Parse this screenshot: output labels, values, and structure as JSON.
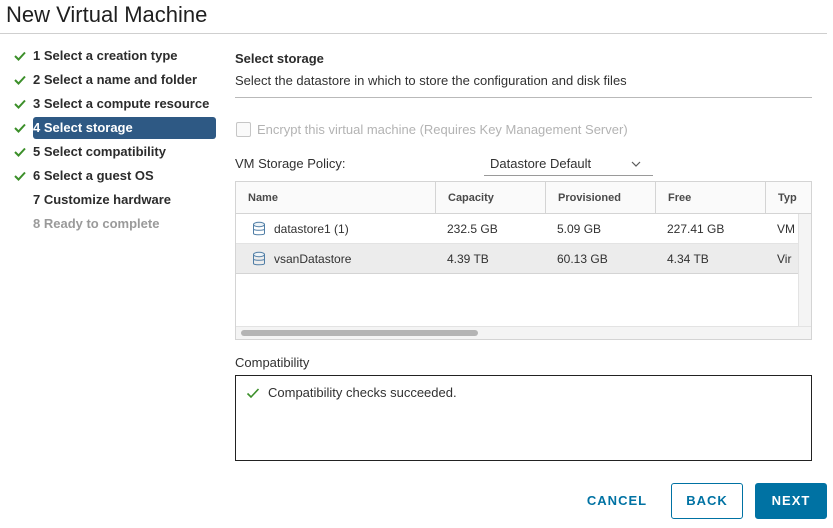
{
  "window": {
    "title": "New Virtual Machine"
  },
  "steps": [
    {
      "label": "1 Select a creation type",
      "state": "done"
    },
    {
      "label": "2 Select a name and folder",
      "state": "done"
    },
    {
      "label": "3 Select a compute resource",
      "state": "done"
    },
    {
      "label": "4 Select storage",
      "state": "active"
    },
    {
      "label": "5 Select compatibility",
      "state": "done"
    },
    {
      "label": "6 Select a guest OS",
      "state": "done"
    },
    {
      "label": "7 Customize hardware",
      "state": "pending"
    },
    {
      "label": "8 Ready to complete",
      "state": "disabled"
    }
  ],
  "section": {
    "heading": "Select storage",
    "description": "Select the datastore in which to store the configuration and disk files"
  },
  "encrypt": {
    "label": "Encrypt this virtual machine (Requires Key Management Server)",
    "checked": false,
    "disabled": true
  },
  "policy": {
    "label": "VM Storage Policy:",
    "value": "Datastore Default"
  },
  "datastores": {
    "columns": [
      "Name",
      "Capacity",
      "Provisioned",
      "Free",
      "Typ"
    ],
    "rows": [
      {
        "name": "datastore1 (1)",
        "capacity": "232.5 GB",
        "provisioned": "5.09 GB",
        "free": "227.41 GB",
        "type": "VM",
        "selected": false
      },
      {
        "name": "vsanDatastore",
        "capacity": "4.39 TB",
        "provisioned": "60.13 GB",
        "free": "4.34 TB",
        "type": "Vir",
        "selected": true
      }
    ]
  },
  "compatibility": {
    "label": "Compatibility",
    "message": "Compatibility checks succeeded."
  },
  "buttons": {
    "cancel": "CANCEL",
    "back": "BACK",
    "next": "NEXT"
  },
  "colors": {
    "accent": "#0072a3",
    "active_step": "#2e5984",
    "success": "#3c8f2a"
  }
}
